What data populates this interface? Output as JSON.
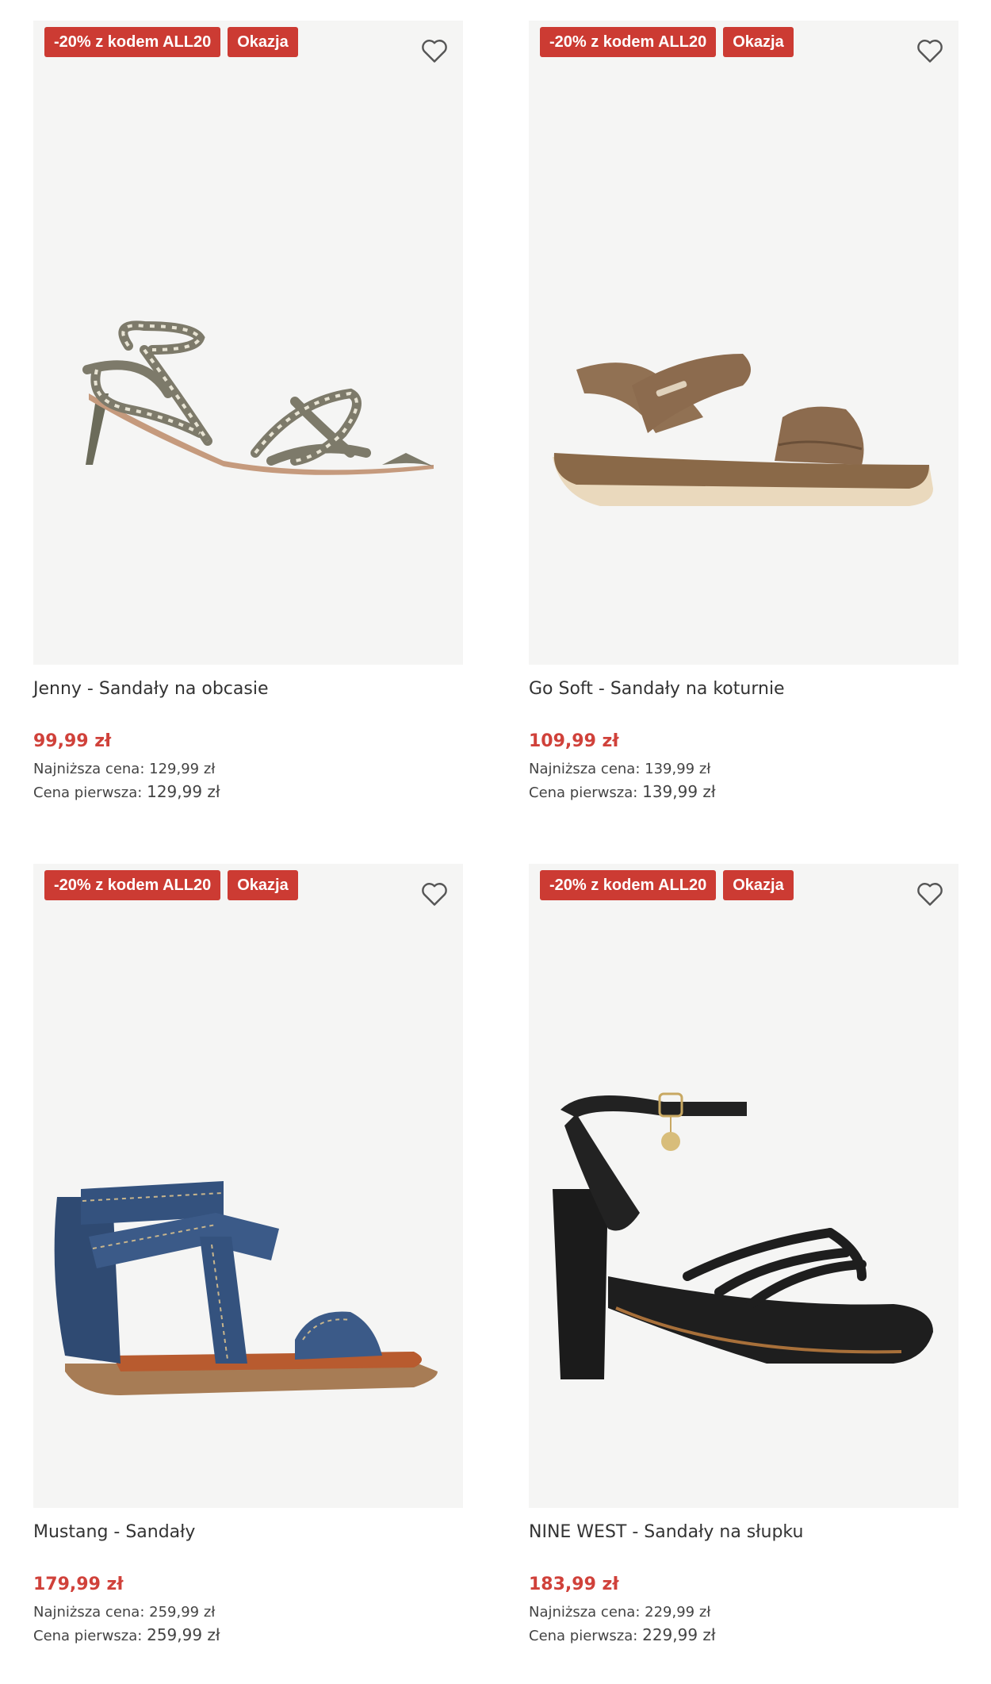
{
  "products": [
    {
      "badge_promo": "-20% z kodem ALL20",
      "badge_deal": "Okazja",
      "name": "Jenny - Sandały na obcasie",
      "price": "99,99 zł",
      "lowest_label": "Najniższa cena:",
      "lowest_value": "129,99 zł",
      "first_label": "Cena pierwsza:",
      "first_value": "129,99 zł"
    },
    {
      "badge_promo": "-20% z kodem ALL20",
      "badge_deal": "Okazja",
      "name": "Go Soft - Sandały na koturnie",
      "price": "109,99 zł",
      "lowest_label": "Najniższa cena:",
      "lowest_value": "139,99 zł",
      "first_label": "Cena pierwsza:",
      "first_value": "139,99 zł"
    },
    {
      "badge_promo": "-20% z kodem ALL20",
      "badge_deal": "Okazja",
      "name": "Mustang - Sandały",
      "price": "179,99 zł",
      "lowest_label": "Najniższa cena:",
      "lowest_value": "259,99 zł",
      "first_label": "Cena pierwsza:",
      "first_value": "259,99 zł"
    },
    {
      "badge_promo": "-20% z kodem ALL20",
      "badge_deal": "Okazja",
      "name": "NINE WEST - Sandały na słupku",
      "price": "183,99 zł",
      "lowest_label": "Najniższa cena:",
      "lowest_value": "229,99 zł",
      "first_label": "Cena pierwsza:",
      "first_value": "229,99 zł"
    }
  ],
  "colors": {
    "badge": "#cc3b33",
    "price": "#d0413a",
    "image_bg": "#f5f5f4"
  },
  "icons": {
    "favorite": "heart-outline-icon"
  }
}
